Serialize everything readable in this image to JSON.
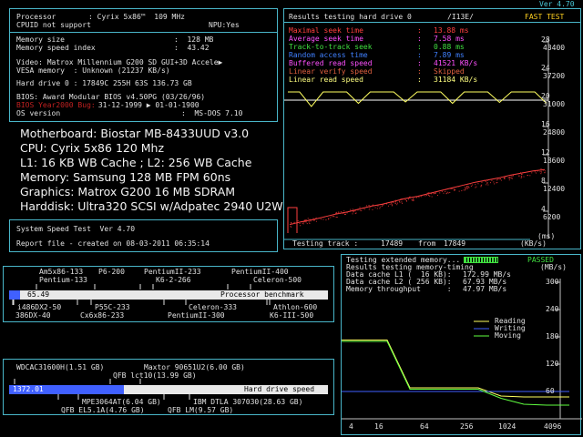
{
  "header": {
    "version": "Ver 4.70"
  },
  "sysinfo": {
    "processor_label": "Processor",
    "processor_value": ": Cyrix 5x86™  109 MHz",
    "cpuid_label": "CPUID not support",
    "npu_value": "NPU:Yes",
    "memsize_label": "Memory size",
    "memsize_value": ":  128 MB",
    "memspeed_label": "Memory speed index",
    "memspeed_value": ":  43.42",
    "video_line": "Video: Matrox Millennium G200 SD GUI+3D Accele▶",
    "vesa_line": "VESA memory  : Unknown (21237 KB/s)",
    "hdd_line": "Hard drive 0 : 17849C 255H 63S 136.73 GB",
    "bios_line": "BIOS: Award Modular BIOS v4.50PG (03/26/96)",
    "bug_label": "BIOS Year2000 Bug:",
    "bug_value": " 31-12-1999 ▶ 01-01-1900",
    "os_label": "OS version",
    "os_value": ":  MS-DOS 7.10"
  },
  "userinfo": {
    "motherboard": "Motherboard: Biostar MB-8433UUD v3.0",
    "cpu": "CPU: Cyrix 5x86 120 Mhz",
    "cache": "L1: 16 KB WB Cache ; L2: 256 WB Cache",
    "memory": "Memory: Samsung 128 MB FPM 60ns",
    "graphics": "Graphics: Matrox G200 16 MB SDRAM",
    "harddisk": "Harddisk: Ultra320 SCSI w/Adpatec 2940 U2W"
  },
  "speedtest": {
    "title": "System Speed Test  Ver 4.70",
    "report": "Report file - created on 08-03-2011 06:35:14"
  },
  "hddtest": {
    "title": "Results testing hard drive 0",
    "mode": "/I13E/",
    "status": "FAST TEST",
    "rows": [
      {
        "label": "Maximal seek time",
        "value": "13.88 ms",
        "color": "#ff4040"
      },
      {
        "label": "Average seek time",
        "value": "7.58 ms",
        "color": "#ff50ff"
      },
      {
        "label": "Track-to-track seek",
        "value": "0.88 ms",
        "color": "#40e040"
      },
      {
        "label": "Random access time",
        "value": "7.89 ms",
        "color": "#4080ff"
      },
      {
        "label": "Buffered read speed",
        "value": "41521 KB/s",
        "color": "#ff50ff"
      },
      {
        "label": "Linear verify speed",
        "value": "Skipped",
        "color": "#e06040"
      },
      {
        "label": "Linear read speed",
        "value": "31184 KB/s",
        "color": "#ffff80"
      }
    ],
    "y_left": [
      "28",
      "24",
      "20",
      "16",
      "12",
      "8",
      "4"
    ],
    "y_right": [
      "43400",
      "37200",
      "31000",
      "24800",
      "18600",
      "12400",
      "6200"
    ],
    "y_left_unit": "(ms)",
    "y_right_unit": "(KB/s)",
    "testing_track_label": "Testing track :",
    "track_current": "17489",
    "track_from": "from",
    "track_total": "17849",
    "chart_data": {
      "type": "line",
      "series": [
        {
          "values": [
            1.2,
            1.6,
            1.9,
            2.3,
            2.7,
            3.0,
            3.4,
            3.8,
            4.1,
            4.5,
            4.9,
            5.2,
            5.6,
            6.0,
            6.4,
            6.8,
            7.2,
            7.5,
            7.8,
            8.2,
            8.5,
            8.8,
            9.0
          ]
        },
        {
          "values": [
            31000,
            31000,
            27800,
            31000,
            31000,
            31000,
            28500,
            31000,
            31000,
            31000,
            28800,
            31000,
            31000,
            31000,
            28500,
            31000,
            31000,
            31000,
            28700,
            31000,
            31000,
            31000,
            28500
          ]
        }
      ]
    }
  },
  "cpu_bench": {
    "top_labels": [
      "Am5x86-133",
      "P6-200",
      "PentiumII-233",
      "PentiumII-400",
      "Pentium-133",
      "K6-2-266",
      "Celeron-500"
    ],
    "score": "65.49",
    "title": "Processor benchmark",
    "bottom_labels": [
      "i486DX2-50",
      "P55C-233",
      "Celeron-333",
      "Athlon-600",
      "386DX-40",
      "Cx6x86-233",
      "PentiumII-300",
      "K6-III-500"
    ],
    "progress": 0.035
  },
  "hdd_bench": {
    "top_labels": [
      "WDCAC31600H(1.51 GB)",
      "Maxtor 90651U2(6.00 GB)",
      "QFB lct10(13.99 GB)"
    ],
    "score": "1372.01",
    "title": "Hard drive speed",
    "bottom_labels": [
      "MPE3064AT(6.04 GB)",
      "IBM DTLA 307030(28.63 GB)",
      "QFB EL5.1A(4.76 GB)",
      "QFB LM(9.57 GB)"
    ],
    "progress": 0.36
  },
  "memtest": {
    "title": "Testing extended memory...",
    "status": "PASSED",
    "results_title": "Results testing memory-timing",
    "unit": "(MB/s)",
    "rows": [
      {
        "label": "Data cache L1 (  16 KB):",
        "value": "172.99 MB/s"
      },
      {
        "label": "Data cache L2 ( 256 KB):",
        "value": "67.93 MB/s"
      },
      {
        "label": "Memory throughput      :",
        "value": "47.97 MB/s"
      }
    ],
    "y_labels": [
      "300",
      "240",
      "180",
      "120",
      "60"
    ],
    "x_labels": [
      "4",
      "16",
      "64",
      "256",
      "1024",
      "4096"
    ],
    "legend": [
      {
        "name": "Reading",
        "color": "#ffff60"
      },
      {
        "name": "Writing",
        "color": "#4060ff"
      },
      {
        "name": "Moving",
        "color": "#60ff40"
      }
    ],
    "chart_data": {
      "type": "line",
      "x": [
        4,
        8,
        16,
        32,
        64,
        128,
        256,
        512,
        1024,
        2048,
        4096
      ],
      "series": [
        {
          "name": "Reading",
          "values": [
            173,
            173,
            173,
            68,
            68,
            68,
            68,
            50,
            48,
            48,
            48
          ]
        },
        {
          "name": "Writing",
          "values": [
            60,
            60,
            60,
            60,
            60,
            60,
            60,
            60,
            60,
            60,
            60
          ]
        },
        {
          "name": "Moving",
          "values": [
            170,
            170,
            170,
            65,
            65,
            65,
            65,
            45,
            32,
            30,
            30
          ]
        }
      ]
    }
  }
}
